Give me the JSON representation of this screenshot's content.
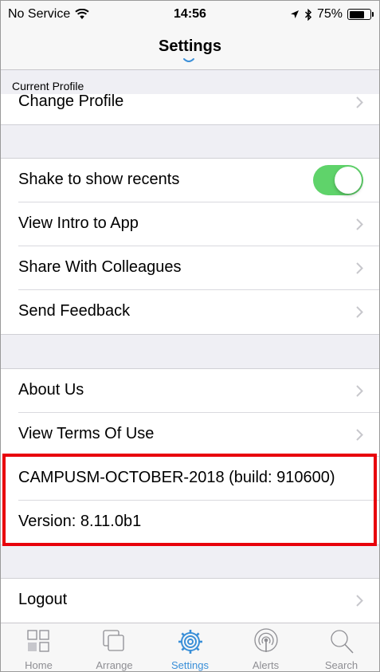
{
  "status_bar": {
    "carrier": "No Service",
    "time": "14:56",
    "battery": "75%",
    "battery_level": 0.75
  },
  "nav": {
    "title": "Settings"
  },
  "sections": {
    "current_profile_header": "Current Profile",
    "change_profile": "Change Profile",
    "shake_to_show_recents": "Shake to show recents",
    "shake_toggle_on": true,
    "view_intro": "View Intro to App",
    "share_colleagues": "Share With Colleagues",
    "send_feedback": "Send Feedback",
    "about_us": "About Us",
    "view_terms": "View Terms Of Use",
    "build_info": "CAMPUSM-OCTOBER-2018 (build: 910600)",
    "version_info": "Version: 8.11.0b1",
    "logout": "Logout"
  },
  "tabs": [
    {
      "label": "Home",
      "icon": "home-grid-icon"
    },
    {
      "label": "Arrange",
      "icon": "arrange-icon"
    },
    {
      "label": "Settings",
      "icon": "settings-gear-icon",
      "active": true
    },
    {
      "label": "Alerts",
      "icon": "alerts-broadcast-icon"
    },
    {
      "label": "Search",
      "icon": "search-icon"
    }
  ],
  "colors": {
    "accent": "#3a8fd8",
    "toggle_on": "#5fd36a",
    "highlight": "#e8000b"
  }
}
